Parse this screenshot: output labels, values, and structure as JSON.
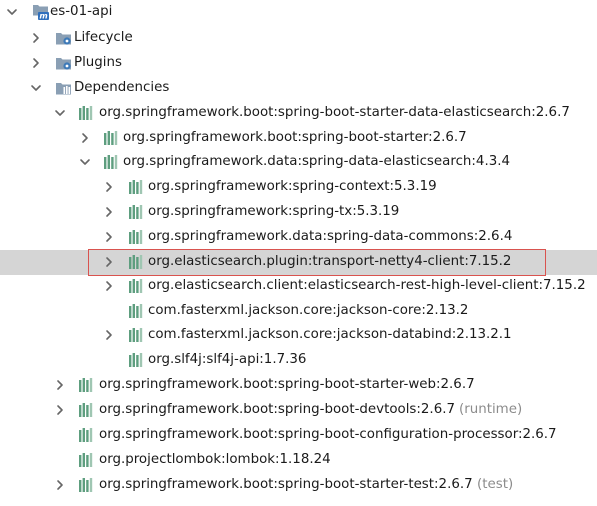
{
  "colors": {
    "lib_icon": "#5e9e7f",
    "folder_icon": "#8a9fb4",
    "arrow": "#666666",
    "selected_row": "#d5d5d5",
    "highlight_border": "#d9534f",
    "scope_text": "#8c8c8c"
  },
  "tree": {
    "rows": [
      {
        "label": "es-01-api",
        "icon": "maven-module-icon",
        "arrow": "expanded",
        "scope": ""
      },
      {
        "label": "Lifecycle",
        "icon": "folder-gear-icon",
        "arrow": "collapsed",
        "scope": ""
      },
      {
        "label": "Plugins",
        "icon": "folder-gear-icon",
        "arrow": "collapsed",
        "scope": ""
      },
      {
        "label": "Dependencies",
        "icon": "folder-library-icon",
        "arrow": "expanded",
        "scope": ""
      },
      {
        "label": "org.springframework.boot:spring-boot-starter-data-elasticsearch:2.6.7",
        "icon": "library-icon",
        "arrow": "expanded",
        "scope": ""
      },
      {
        "label": "org.springframework.boot:spring-boot-starter:2.6.7",
        "icon": "library-icon",
        "arrow": "collapsed",
        "scope": ""
      },
      {
        "label": "org.springframework.data:spring-data-elasticsearch:4.3.4",
        "icon": "library-icon",
        "arrow": "expanded",
        "scope": ""
      },
      {
        "label": "org.springframework:spring-context:5.3.19",
        "icon": "library-icon",
        "arrow": "collapsed",
        "scope": ""
      },
      {
        "label": "org.springframework:spring-tx:5.3.19",
        "icon": "library-icon",
        "arrow": "collapsed",
        "scope": ""
      },
      {
        "label": "org.springframework.data:spring-data-commons:2.6.4",
        "icon": "library-icon",
        "arrow": "collapsed",
        "scope": ""
      },
      {
        "label": "org.elasticsearch.plugin:transport-netty4-client:7.15.2",
        "icon": "library-icon",
        "arrow": "collapsed",
        "scope": ""
      },
      {
        "label": "org.elasticsearch.client:elasticsearch-rest-high-level-client:7.15.2",
        "icon": "library-icon",
        "arrow": "collapsed",
        "scope": ""
      },
      {
        "label": "com.fasterxml.jackson.core:jackson-core:2.13.2",
        "icon": "library-icon",
        "arrow": "none",
        "scope": ""
      },
      {
        "label": "com.fasterxml.jackson.core:jackson-databind:2.13.2.1",
        "icon": "library-icon",
        "arrow": "collapsed",
        "scope": ""
      },
      {
        "label": "org.slf4j:slf4j-api:1.7.36",
        "icon": "library-icon",
        "arrow": "none",
        "scope": ""
      },
      {
        "label": "org.springframework.boot:spring-boot-starter-web:2.6.7",
        "icon": "library-icon",
        "arrow": "collapsed",
        "scope": ""
      },
      {
        "label": "org.springframework.boot:spring-boot-devtools:2.6.7",
        "icon": "library-icon",
        "arrow": "collapsed",
        "scope": "(runtime)"
      },
      {
        "label": "org.springframework.boot:spring-boot-configuration-processor:2.6.7",
        "icon": "library-icon",
        "arrow": "none",
        "scope": ""
      },
      {
        "label": "org.projectlombok:lombok:1.18.24",
        "icon": "library-icon",
        "arrow": "none",
        "scope": ""
      },
      {
        "label": "org.springframework.boot:spring-boot-starter-test:2.6.7",
        "icon": "library-icon",
        "arrow": "collapsed",
        "scope": "(test)"
      }
    ]
  }
}
